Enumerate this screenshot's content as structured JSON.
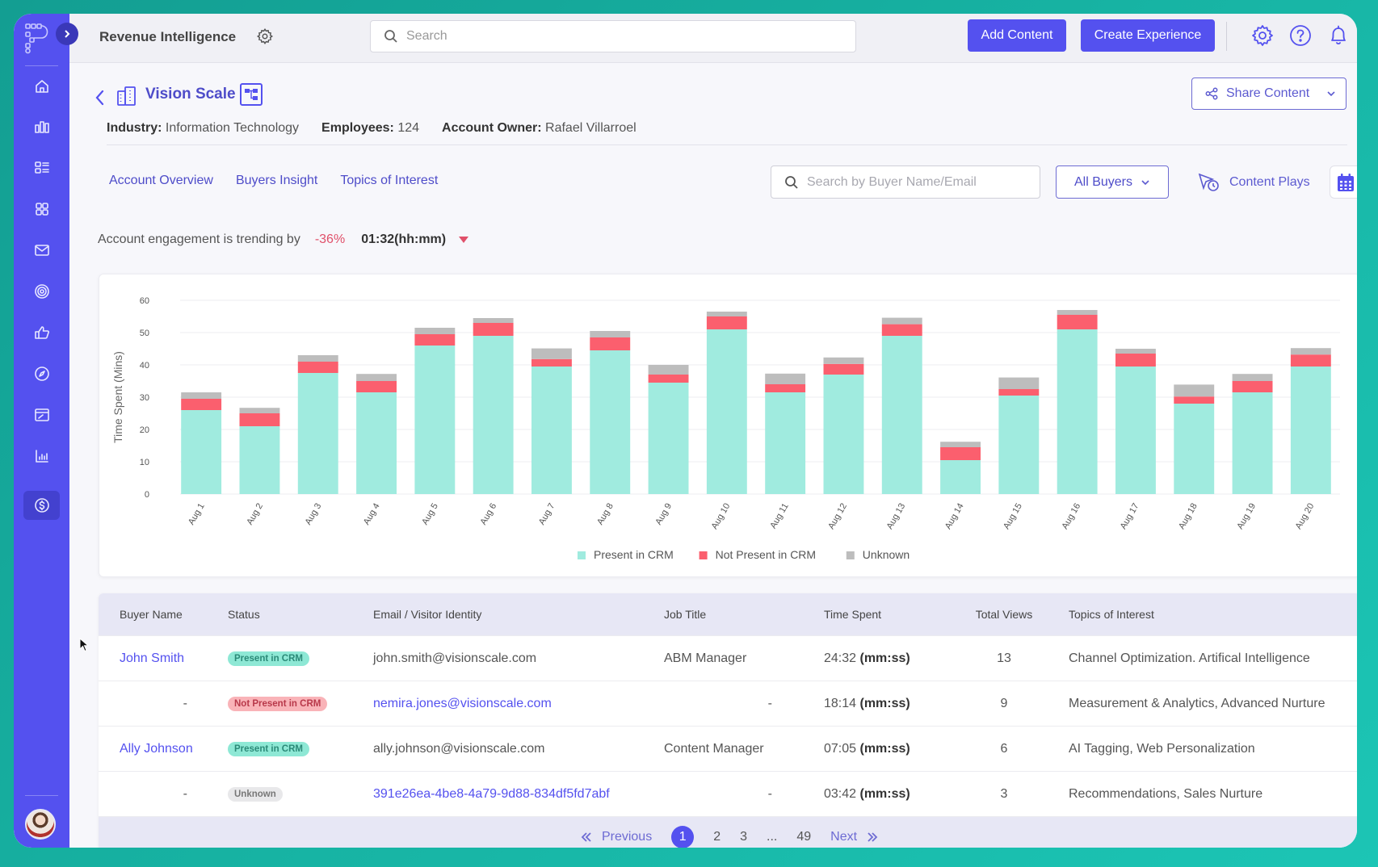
{
  "header": {
    "app_title": "Revenue Intelligence",
    "search_placeholder": "Search",
    "add_content_label": "Add Content",
    "create_experience_label": "Create Experience"
  },
  "sidebar": {
    "items": [
      {
        "icon": "home-icon"
      },
      {
        "icon": "analytics-icon"
      },
      {
        "icon": "layout-icon"
      },
      {
        "icon": "apps-grid-icon"
      },
      {
        "icon": "mail-icon"
      },
      {
        "icon": "target-icon"
      },
      {
        "icon": "thumbs-up-icon"
      },
      {
        "icon": "compass-icon"
      },
      {
        "icon": "browser-window-icon"
      },
      {
        "icon": "bar-chart-icon"
      },
      {
        "icon": "dollar-icon",
        "active": true
      }
    ]
  },
  "account": {
    "name": "Vision Scale",
    "industry_label": "Industry:",
    "industry": "Information Technology",
    "employees_label": "Employees:",
    "employees": "124",
    "owner_label": "Account Owner:",
    "owner": "Rafael Villarroel",
    "share_label": "Share Content"
  },
  "tabs": [
    "Account Overview",
    "Buyers Insight",
    "Topics of Interest"
  ],
  "filters": {
    "buyer_search_placeholder": "Search by Buyer Name/Email",
    "buyer_filter": "All Buyers",
    "content_plays_label": "Content Plays"
  },
  "trend": {
    "text": "Account engagement is trending by",
    "percent": "-36%",
    "time": "01:32(hh:mm)",
    "direction": "down"
  },
  "colors": {
    "accent": "#5451ef",
    "present": "#a0ebdf",
    "not_present": "#fb5f6e",
    "unknown": "#bdbdbd"
  },
  "chart_data": {
    "type": "bar",
    "stacked": true,
    "title": "",
    "xlabel": "",
    "ylabel": "Time Spent (Mins)",
    "ylim": [
      0,
      60
    ],
    "yticks": [
      0,
      10,
      20,
      30,
      40,
      50,
      60
    ],
    "grid": true,
    "legend_position": "bottom-center",
    "categories": [
      "Aug 1",
      "Aug 2",
      "Aug 3",
      "Aug 4",
      "Aug 5",
      "Aug 6",
      "Aug 7",
      "Aug 8",
      "Aug 9",
      "Aug 10",
      "Aug 11",
      "Aug 12",
      "Aug 13",
      "Aug 14",
      "Aug 15",
      "Aug 16",
      "Aug 17",
      "Aug 18",
      "Aug 19",
      "Aug 20"
    ],
    "series": [
      {
        "name": "Present in CRM",
        "color": "#a0ebdf",
        "values": [
          26,
          21,
          37.5,
          31.5,
          46,
          49,
          39.5,
          44.5,
          34.5,
          51,
          31.5,
          37,
          49,
          10.5,
          30.5,
          51,
          39.5,
          28,
          31.5,
          39.5
        ]
      },
      {
        "name": "Not Present in CRM",
        "color": "#fb5f6e",
        "values": [
          3.5,
          4,
          3.5,
          3.5,
          3.5,
          4,
          2.3,
          4,
          2.5,
          4,
          2.5,
          3.3,
          3.6,
          4,
          2,
          4.5,
          4,
          2.2,
          3.5,
          3.7
        ]
      },
      {
        "name": "Unknown",
        "color": "#bdbdbd",
        "values": [
          2,
          1.7,
          2,
          2.2,
          2,
          1.5,
          3.3,
          2,
          3,
          1.5,
          3.3,
          2,
          2,
          1.7,
          3.6,
          1.5,
          1.5,
          3.7,
          2.2,
          2
        ]
      }
    ]
  },
  "table": {
    "columns": [
      "Buyer Name",
      "Status",
      "Email / Visitor Identity",
      "Job Title",
      "Time Spent",
      "Total Views",
      "Topics of Interest"
    ],
    "rows": [
      {
        "buyer": "John Smith",
        "status": "Present in CRM",
        "status_type": "present",
        "email": "john.smith@visionscale.com",
        "email_link": false,
        "job": "ABM Manager",
        "time": "24:32",
        "time_unit": "(mm:ss)",
        "views": "13",
        "topics": "Channel Optimization. Artifical Intelligence"
      },
      {
        "buyer": "-",
        "status": "Not Present in CRM",
        "status_type": "notpresent",
        "email": "nemira.jones@visionscale.com",
        "email_link": true,
        "job": "-",
        "time": "18:14",
        "time_unit": "(mm:ss)",
        "views": "9",
        "topics": "Measurement & Analytics, Advanced Nurture"
      },
      {
        "buyer": "Ally Johnson",
        "status": "Present in CRM",
        "status_type": "present",
        "email": "ally.johnson@visionscale.com",
        "email_link": false,
        "job": "Content Manager",
        "time": "07:05",
        "time_unit": "(mm:ss)",
        "views": "6",
        "topics": "AI Tagging, Web Personalization"
      },
      {
        "buyer": "-",
        "status": "Unknown",
        "status_type": "unknown",
        "email": "391e26ea-4be8-4a79-9d88-834df5fd7abf",
        "email_link": true,
        "job": "-",
        "time": "03:42",
        "time_unit": "(mm:ss)",
        "views": "3",
        "topics": "Recommendations, Sales Nurture"
      }
    ]
  },
  "pagination": {
    "previous_label": "Previous",
    "next_label": "Next",
    "pages": [
      "1",
      "2",
      "3",
      "...",
      "49"
    ],
    "current": "1"
  }
}
